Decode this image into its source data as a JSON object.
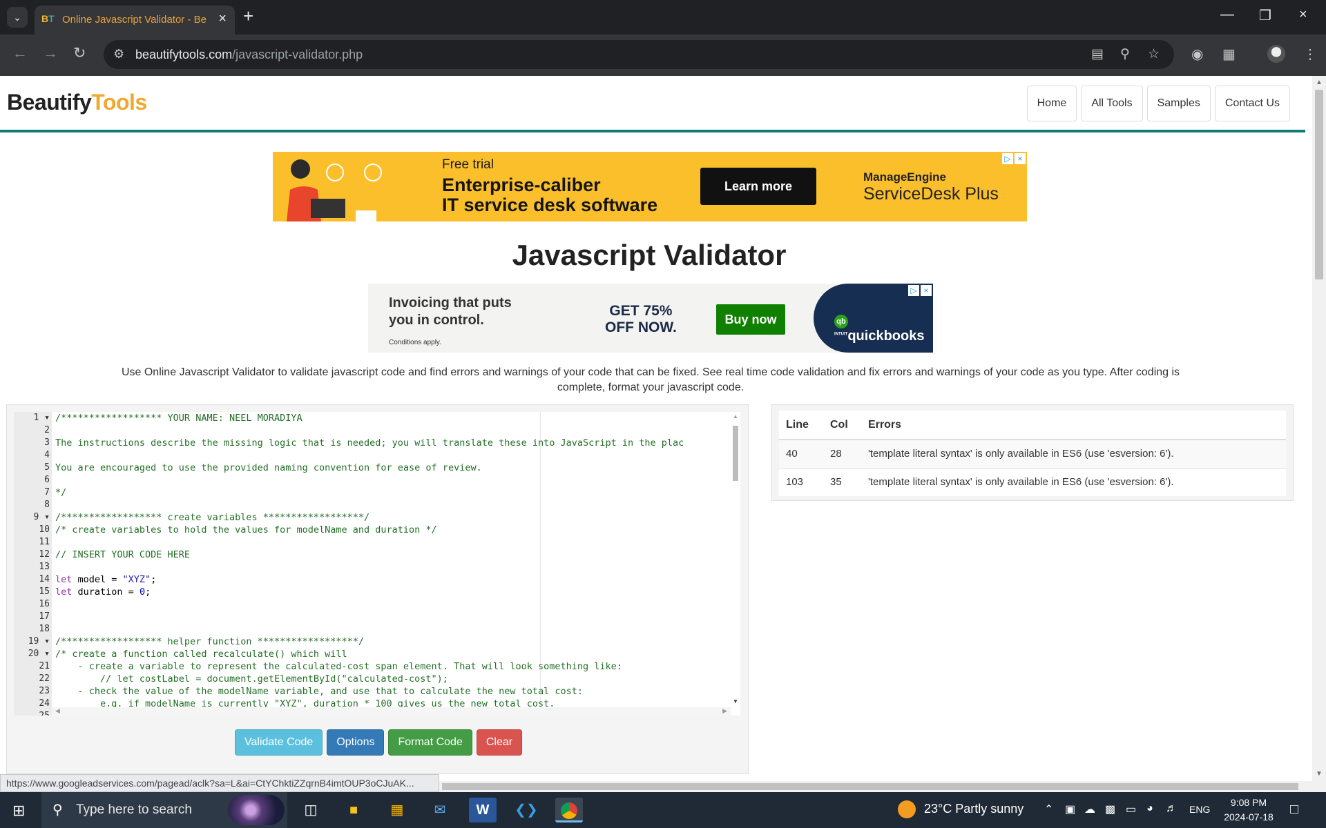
{
  "browser": {
    "tab_title": "Online Javascript Validator - Be",
    "url_host": "beautifytools.com",
    "url_path": "/javascript-validator.php"
  },
  "site": {
    "logo_part1": "Beautify",
    "logo_part2": "Tools",
    "nav": [
      "Home",
      "All Tools",
      "Samples",
      "Contact Us"
    ]
  },
  "ad1": {
    "small": "Free trial",
    "headline1": "Enterprise-caliber",
    "headline2": "IT service desk software",
    "button": "Learn more",
    "brand_top": "ManageEngine",
    "brand": "ServiceDesk Plus"
  },
  "page_title": "Javascript Validator",
  "ad2": {
    "text1": "Invoicing that puts",
    "text2": "you in control.",
    "conditions": "Conditions apply.",
    "offer1": "GET 75%",
    "offer2": "OFF NOW.",
    "button": "Buy now",
    "brand": "quickbooks",
    "brand_top": "INTUIT"
  },
  "description": "Use Online Javascript Validator to validate javascript code and find errors and warnings of your code that can be fixed. See real time code validation and fix errors and warnings of your code as you type. After coding is complete, format your javascript code.",
  "editor": {
    "lines": [
      [
        [
          "c-comment",
          "/****************** YOUR NAME: NEEL MORADIYA"
        ]
      ],
      [],
      [
        [
          "c-comment",
          "The instructions describe the missing logic that is needed; you will translate these into JavaScript in the plac"
        ]
      ],
      [],
      [
        [
          "c-comment",
          "You are encouraged to use the provided naming convention for ease of review."
        ]
      ],
      [],
      [
        [
          "c-comment",
          "*/"
        ]
      ],
      [],
      [
        [
          "c-comment",
          "/****************** create variables ******************/"
        ]
      ],
      [
        [
          "c-comment",
          "/* create variables to hold the values for modelName and duration */"
        ]
      ],
      [],
      [
        [
          "c-comment",
          "// INSERT YOUR CODE HERE"
        ]
      ],
      [],
      [
        [
          "c-kw",
          "let"
        ],
        [
          "c-plain",
          " model = "
        ],
        [
          "c-str",
          "\"XYZ\""
        ],
        [
          "c-plain",
          ";"
        ]
      ],
      [
        [
          "c-kw",
          "let"
        ],
        [
          "c-plain",
          " duration = "
        ],
        [
          "c-num",
          "0"
        ],
        [
          "c-plain",
          ";"
        ]
      ],
      [],
      [],
      [],
      [
        [
          "c-comment",
          "/****************** helper function ******************/"
        ]
      ],
      [
        [
          "c-comment",
          "/* create a function called recalculate() which will"
        ]
      ],
      [
        [
          "c-comment",
          "    - create a variable to represent the calculated-cost span element. That will look something like:"
        ]
      ],
      [
        [
          "c-comment",
          "        // let costLabel = document.getElementById(\"calculated-cost\");"
        ]
      ],
      [
        [
          "c-comment",
          "    - check the value of the modelName variable, and use that to calculate the new total cost:"
        ]
      ],
      [
        [
          "c-comment",
          "        e.g. if modelName is currently \"XYZ\", duration * 100 gives us the new total cost."
        ]
      ],
      []
    ],
    "folds": [
      1,
      9,
      19,
      20
    ],
    "buttons": {
      "validate": "Validate Code",
      "options": "Options",
      "format": "Format Code",
      "clear": "Clear"
    }
  },
  "errors": {
    "headers": [
      "Line",
      "Col",
      "Errors"
    ],
    "rows": [
      {
        "line": "40",
        "col": "28",
        "message": "'template literal syntax' is only available in ES6 (use 'esversion: 6')."
      },
      {
        "line": "103",
        "col": "35",
        "message": "'template literal syntax' is only available in ES6 (use 'esversion: 6')."
      }
    ]
  },
  "status_link": "https://www.googleadservices.com/pagead/aclk?sa=L&ai=CtYChktiZZqrnB4imtOUP3oCJuAK...",
  "taskbar": {
    "search_placeholder": "Type here to search",
    "weather": "23°C  Partly sunny",
    "language": "ENG",
    "time": "9:08 PM",
    "date": "2024-07-18"
  }
}
